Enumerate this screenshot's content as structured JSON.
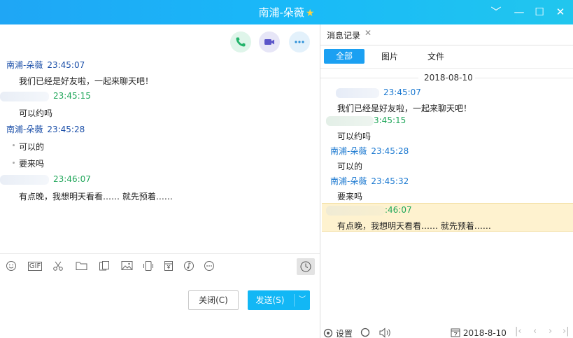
{
  "window": {
    "title": "南浦-朵薇",
    "controls": {
      "chevron": "﹀",
      "minimize": "—",
      "maximize": "☐",
      "close": "✕"
    }
  },
  "chat": {
    "messages": [
      {
        "sender": "南浦-朵薇",
        "time": "23:45:07",
        "text": "我们已经是好友啦，一起来聊天吧！"
      },
      {
        "sender": "",
        "time": "23:45:15",
        "text": "可以约吗"
      },
      {
        "sender": "南浦-朵薇",
        "time": "23:45:28",
        "text": "可以的"
      },
      {
        "sender": "",
        "time": "",
        "text": "要来吗"
      },
      {
        "sender": "",
        "time": "23:46:07",
        "text": "有点晚，我想明天看看…… 就先预着……"
      }
    ],
    "toolbar": {
      "gif_label": "GIF"
    },
    "close_label": "关闭(C)",
    "send_label": "发送(S)"
  },
  "history": {
    "tab_label": "消息记录",
    "filters": {
      "all": "全部",
      "images": "图片",
      "files": "文件"
    },
    "date": "2018-08-10",
    "messages": [
      {
        "sender": "",
        "time": "23:45:07",
        "text": "我们已经是好友啦，一起来聊天吧！"
      },
      {
        "sender": "",
        "time": "3:45:15",
        "text": "可以约吗"
      },
      {
        "sender": "南浦-朵薇",
        "time": "23:45:28",
        "text": "可以的"
      },
      {
        "sender": "南浦-朵薇",
        "time": "23:45:32",
        "text": "要来吗"
      },
      {
        "sender": "",
        "time": ":46:07",
        "text": "有点晚，我想明天看看…… 就先预着……"
      }
    ],
    "settings_label": "设置",
    "calendar_date": "2018-8-10"
  },
  "colors": {
    "titlebar": "#1fa6f5",
    "send_button": "#12b7f5",
    "selected_filter": "#1ba0f2",
    "highlight_row": "#fef2cf"
  }
}
